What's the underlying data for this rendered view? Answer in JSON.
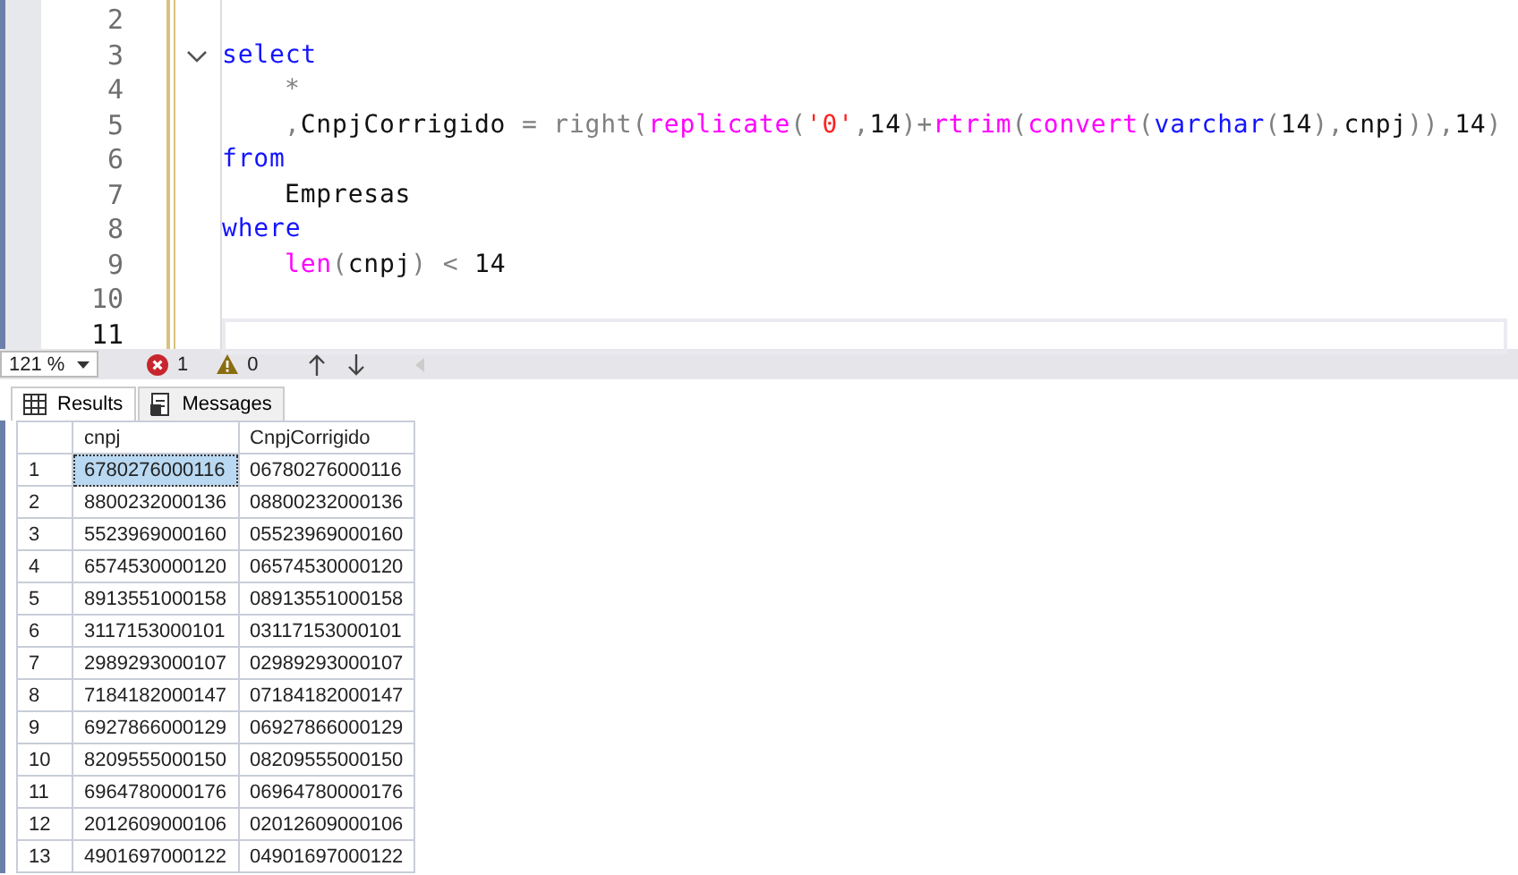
{
  "editor": {
    "lines": [
      {
        "number": "2",
        "current": false
      },
      {
        "number": "3",
        "indented": false,
        "foldable": true,
        "current": false,
        "tokens": [
          {
            "kind": "kw",
            "text": "select"
          }
        ]
      },
      {
        "number": "4",
        "indented": true,
        "current": false,
        "tokens": [
          {
            "kind": "op",
            "text": "*"
          }
        ]
      },
      {
        "number": "5",
        "indented": true,
        "current": false,
        "tokens": [
          {
            "kind": "op",
            "text": ","
          },
          {
            "kind": "text",
            "text": "CnpjCorrigido "
          },
          {
            "kind": "op",
            "text": "= right("
          },
          {
            "kind": "fn",
            "text": "replicate"
          },
          {
            "kind": "op",
            "text": "("
          },
          {
            "kind": "str",
            "text": "'0'"
          },
          {
            "kind": "op",
            "text": ","
          },
          {
            "kind": "text",
            "text": "14"
          },
          {
            "kind": "op",
            "text": ")+"
          },
          {
            "kind": "fn",
            "text": "rtrim"
          },
          {
            "kind": "op",
            "text": "("
          },
          {
            "kind": "fn",
            "text": "convert"
          },
          {
            "kind": "op",
            "text": "("
          },
          {
            "kind": "kw",
            "text": "varchar"
          },
          {
            "kind": "op",
            "text": "("
          },
          {
            "kind": "text",
            "text": "14"
          },
          {
            "kind": "op",
            "text": "),"
          },
          {
            "kind": "text",
            "text": "cnpj"
          },
          {
            "kind": "op",
            "text": ")),"
          },
          {
            "kind": "text",
            "text": "14"
          },
          {
            "kind": "op",
            "text": ")"
          }
        ]
      },
      {
        "number": "6",
        "indented": false,
        "current": false,
        "tokens": [
          {
            "kind": "kw",
            "text": "from"
          }
        ]
      },
      {
        "number": "7",
        "indented": true,
        "current": false,
        "tokens": [
          {
            "kind": "text",
            "text": "Empresas"
          }
        ]
      },
      {
        "number": "8",
        "indented": false,
        "current": false,
        "tokens": [
          {
            "kind": "kw",
            "text": "where"
          }
        ]
      },
      {
        "number": "9",
        "indented": true,
        "current": false,
        "tokens": [
          {
            "kind": "fn",
            "text": "len"
          },
          {
            "kind": "op",
            "text": "("
          },
          {
            "kind": "text",
            "text": "cnpj"
          },
          {
            "kind": "op",
            "text": ") < "
          },
          {
            "kind": "text",
            "text": "14"
          }
        ]
      },
      {
        "number": "10",
        "current": false
      },
      {
        "number": "11",
        "current": true
      }
    ]
  },
  "status_bar": {
    "zoom": "121 %",
    "errors": "1",
    "warnings": "0"
  },
  "tabs": [
    {
      "label": "Results",
      "selected": true
    },
    {
      "label": "Messages",
      "selected": false
    }
  ],
  "grid": {
    "columns": [
      "cnpj",
      "CnpjCorrigido"
    ],
    "rows": [
      {
        "number": "1",
        "cells": [
          {
            "text": "6780276000116",
            "selected": true
          },
          {
            "text": "06780276000116",
            "selected": false
          }
        ]
      },
      {
        "number": "2",
        "cells": [
          {
            "text": "8800232000136",
            "selected": false
          },
          {
            "text": "08800232000136",
            "selected": false
          }
        ]
      },
      {
        "number": "3",
        "cells": [
          {
            "text": "5523969000160",
            "selected": false
          },
          {
            "text": "05523969000160",
            "selected": false
          }
        ]
      },
      {
        "number": "4",
        "cells": [
          {
            "text": "6574530000120",
            "selected": false
          },
          {
            "text": "06574530000120",
            "selected": false
          }
        ]
      },
      {
        "number": "5",
        "cells": [
          {
            "text": "8913551000158",
            "selected": false
          },
          {
            "text": "08913551000158",
            "selected": false
          }
        ]
      },
      {
        "number": "6",
        "cells": [
          {
            "text": "3117153000101",
            "selected": false
          },
          {
            "text": "03117153000101",
            "selected": false
          }
        ]
      },
      {
        "number": "7",
        "cells": [
          {
            "text": "2989293000107",
            "selected": false
          },
          {
            "text": "02989293000107",
            "selected": false
          }
        ]
      },
      {
        "number": "8",
        "cells": [
          {
            "text": "7184182000147",
            "selected": false
          },
          {
            "text": "07184182000147",
            "selected": false
          }
        ]
      },
      {
        "number": "9",
        "cells": [
          {
            "text": "6927866000129",
            "selected": false
          },
          {
            "text": "06927866000129",
            "selected": false
          }
        ]
      },
      {
        "number": "10",
        "cells": [
          {
            "text": "8209555000150",
            "selected": false
          },
          {
            "text": "08209555000150",
            "selected": false
          }
        ]
      },
      {
        "number": "11",
        "cells": [
          {
            "text": "6964780000176",
            "selected": false
          },
          {
            "text": "06964780000176",
            "selected": false
          }
        ]
      },
      {
        "number": "12",
        "cells": [
          {
            "text": "2012609000106",
            "selected": false
          },
          {
            "text": "02012609000106",
            "selected": false
          }
        ]
      },
      {
        "number": "13",
        "cells": [
          {
            "text": "4901697000122",
            "selected": false
          },
          {
            "text": "04901697000122",
            "selected": false
          }
        ]
      }
    ]
  }
}
